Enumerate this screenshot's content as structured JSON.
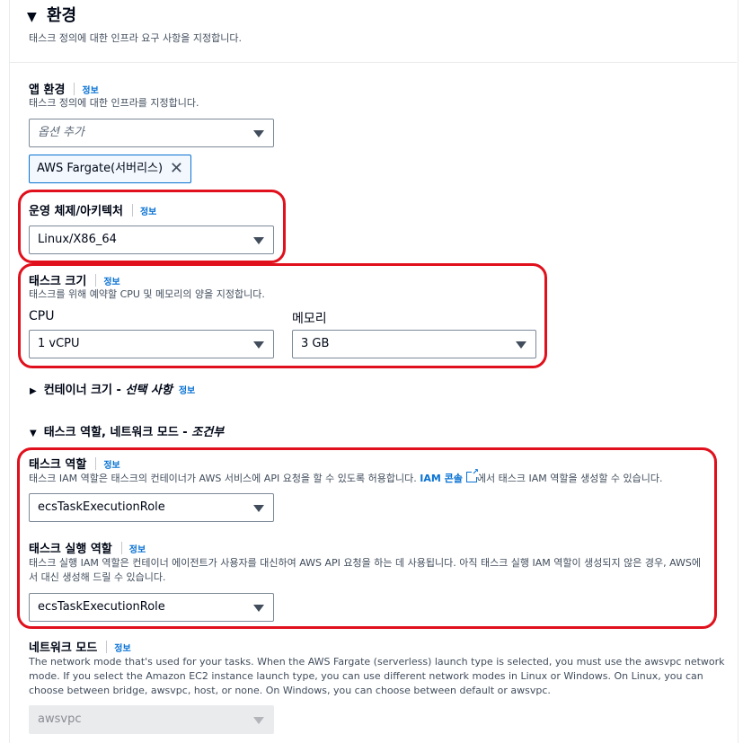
{
  "section": {
    "title": "환경",
    "description": "태스크 정의에 대한 인프라 요구 사항을 지정합니다."
  },
  "info_label": "정보",
  "app_env": {
    "label": "앱 환경",
    "description": "태스크 정의에 대한 인프라를 지정합니다.",
    "placeholder": "옵션 추가",
    "token": "AWS Fargate(서버리스)"
  },
  "os_arch": {
    "label": "운영 체제/아키텍처",
    "value": "Linux/X86_64"
  },
  "task_size": {
    "label": "태스크 크기",
    "description": "태스크를 위해 예약할 CPU 및 메모리의 양을 지정합니다.",
    "cpu_label": "CPU",
    "cpu_value": "1 vCPU",
    "memory_label": "메모리",
    "memory_value": "3 GB"
  },
  "container_size": {
    "label": "컨테이너 크기 - ",
    "optional": "선택 사항"
  },
  "roles_section": {
    "label": "태스크 역할, 네트워크 모드 - ",
    "conditional": "조건부"
  },
  "task_role": {
    "label": "태스크 역할",
    "description_prefix": "태스크 IAM 역할은 태스크의 컨테이너가 AWS 서비스에 API 요청을 할 수 있도록 허용합니다.",
    "iam_link": "IAM 콘솔",
    "description_suffix": "에서 태스크 IAM 역할을 생성할 수 있습니다.",
    "value": "ecsTaskExecutionRole"
  },
  "exec_role": {
    "label": "태스크 실행 역할",
    "description_line1": "태스크 실행 IAM 역할은 컨테이너 에이전트가 사용자를 대신하여 AWS API 요청을 하는 데 사용됩니다. 아직 태스크 실행 IAM 역할이 생성되지 않은 경우, AWS에",
    "description_line2": "서 대신 생성해 드릴 수 있습니다.",
    "value": "ecsTaskExecutionRole"
  },
  "network_mode": {
    "label": "네트워크 모드",
    "description_line1": "The network mode that's used for your tasks. When the AWS Fargate (serverless) launch type is selected, you must use the awsvpc network",
    "description_line2": "mode. If you select the Amazon EC2 instance launch type, you can use different network modes in Linux or Windows. On Linux, you can",
    "description_line3": "choose between bridge, awsvpc, host, or none. On Windows, you can choose between default or awsvpc.",
    "value": "awsvpc"
  },
  "colors": {
    "highlight": "#e0101c",
    "link": "#0972d3"
  }
}
